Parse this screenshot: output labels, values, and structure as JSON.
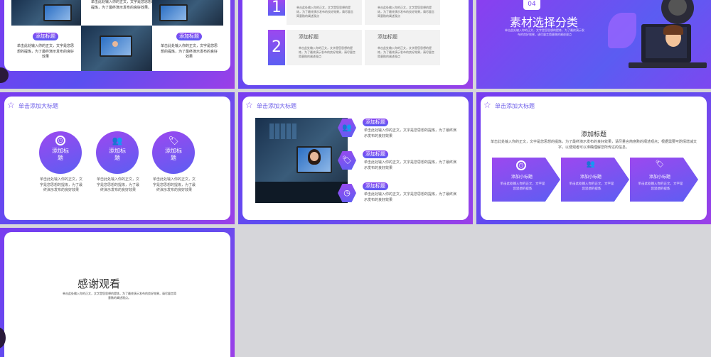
{
  "colors": {
    "accent": "#7c4df0",
    "accent2": "#5c5ef2",
    "bg": "#d6d6da"
  },
  "slide1": {
    "top_text": "单击此处输入你的正文，文字是您思想的提炼，为了最终演示发布的良好效果。",
    "left_badge": "添加标题",
    "left_text": "单击此处输入你的正文，文字是您思想的提炼，为了最终演示发布的良好效果",
    "right_badge": "添加标题",
    "right_text": "单击此处输入你的正文，文字是您思想的提炼，为了最终演示发布的良好效果"
  },
  "slide2": {
    "items": [
      {
        "num": "1",
        "title": "",
        "text": "单击此处输入你的正文，文字是您思想的提炼，为了最终演示发布的良好效果，请尽量言简意赅的阐述观点"
      },
      {
        "num": "",
        "title": "",
        "text": "单击此处输入你的正文，文字是您思想的提炼，为了最终演示发布的良好效果，请尽量言简意赅的阐述观点"
      },
      {
        "num": "2",
        "title": "添加标题",
        "text": "单击此处输入你的正文，文字是您思想的提炼，为了最终演示发布的良好效果，请尽量言简意赅的阐述观点"
      },
      {
        "num": "",
        "title": "添加标题",
        "text": "单击此处输入你的正文，文字是您思想的提炼，为了最终演示发布的良好效果，请尽量言简意赅的阐述观点"
      }
    ]
  },
  "slide3": {
    "num": "04",
    "title": "素材选择分类",
    "sub": "单击此处输入你的正文，文字是您思想的提炼，为了最终演示发布的良好效果，请尽量言简意赅的阐述观点"
  },
  "slide4": {
    "header": "单击添加大标题",
    "circles": [
      {
        "icon": "clock-icon",
        "title": "添加标题",
        "text": "单击此处输入你的正文，文字是您思想的提炼，为了最终演示发布的良好效果"
      },
      {
        "icon": "users-icon",
        "title": "添加标题",
        "text": "单击此处输入你的正文，文字是您思想的提炼，为了最终演示发布的良好效果"
      },
      {
        "icon": "tag-icon",
        "title": "添加标题",
        "text": "单击此处输入你的正文，文字是您思想的提炼，为了最终演示发布的良好效果"
      }
    ]
  },
  "slide5": {
    "header": "单击添加大标题",
    "items": [
      {
        "badge": "添加标题",
        "text": "单击此处输入你的正文，文字是您思想的提炼，为了最终演示发布的良好效果"
      },
      {
        "badge": "添加标题",
        "text": "单击此处输入你的正文，文字是您思想的提炼，为了最终演示发布的良好效果"
      },
      {
        "badge": "添加标题",
        "text": "单击此处输入你的正文，文字是您思想的提炼，为了最终演示发布的良好效果"
      }
    ]
  },
  "slide6": {
    "header": "单击添加大标题",
    "title": "添加标题",
    "text": "单击此处输入你的正文，文字是您思想的提炼，为了最终演示发布的良好效果，请尽量言简意赅的阐述观点；根据需要可酌情增减文字，以便观者可以准确理解您所传达的信息。",
    "arrows": [
      {
        "title": "添加小标题",
        "text": "单击此处输入你的正文，文字是您思想的提炼"
      },
      {
        "title": "添加小标题",
        "text": "单击此处输入你的正文，文字是您思想的提炼"
      },
      {
        "title": "添加小标题",
        "text": "单击此处输入你的正文，文字是您思想的提炼"
      }
    ]
  },
  "slide7": {
    "title": "感谢观看",
    "text": "单击此处输入你的正文，文字是您思想的提炼，为了最终演示发布的良好效果，请尽量言简意赅的阐述观点。"
  }
}
